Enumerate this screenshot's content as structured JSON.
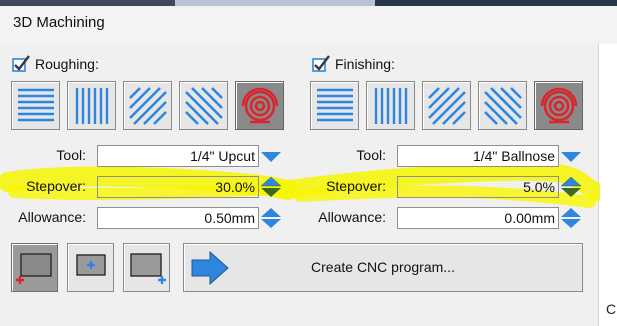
{
  "window": {
    "title": "3D Machining"
  },
  "colors": {
    "accent": "#2e86de",
    "stepover_highlight": "#f7f600",
    "active_strategy": "#d9262c"
  },
  "roughing": {
    "label": "Roughing:",
    "enabled": true,
    "strategies": [
      {
        "icon": "horizontal-lines-icon"
      },
      {
        "icon": "vertical-lines-icon"
      },
      {
        "icon": "diagonal-lines-icon"
      },
      {
        "icon": "anti-diagonal-lines-icon"
      },
      {
        "icon": "offset-spiral-icon",
        "selected": true
      }
    ],
    "tool_label": "Tool:",
    "tool_value": "1/4\" Upcut",
    "stepover_label": "Stepover:",
    "stepover_value": "30.0%",
    "allowance_label": "Allowance:",
    "allowance_value": "0.50mm"
  },
  "finishing": {
    "label": "Finishing:",
    "enabled": true,
    "strategies": [
      {
        "icon": "horizontal-lines-icon"
      },
      {
        "icon": "vertical-lines-icon"
      },
      {
        "icon": "diagonal-lines-icon"
      },
      {
        "icon": "anti-diagonal-lines-icon"
      },
      {
        "icon": "offset-spiral-icon",
        "selected": true
      }
    ],
    "tool_label": "Tool:",
    "tool_value": "1/4\" Ballnose",
    "stepover_label": "Stepover:",
    "stepover_value": "5.0%",
    "allowance_label": "Allowance:",
    "allowance_value": "0.00mm"
  },
  "actions": {
    "boundary_icons": [
      "boundary-remove-icon",
      "boundary-add-inside-icon",
      "boundary-add-corner-icon"
    ],
    "create_label": "Create CNC program..."
  },
  "edge_text": "C"
}
